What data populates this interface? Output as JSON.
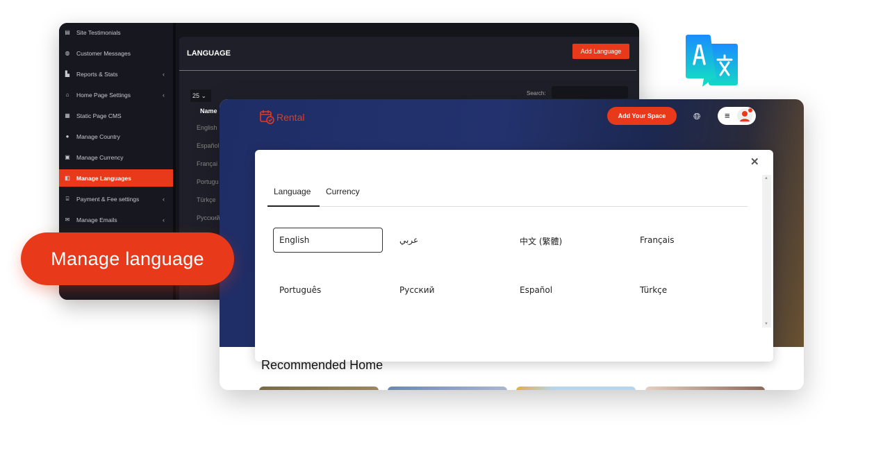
{
  "admin": {
    "sidebar": [
      {
        "label": "Site Testimonials",
        "icon": "testimonial-icon",
        "chevron": false
      },
      {
        "label": "Customer Messages",
        "icon": "chat-icon",
        "chevron": false
      },
      {
        "label": "Reports & Stats",
        "icon": "chart-icon",
        "chevron": true
      },
      {
        "label": "Home Page Settings",
        "icon": "home-icon",
        "chevron": true
      },
      {
        "label": "Static Page CMS",
        "icon": "page-icon",
        "chevron": false
      },
      {
        "label": "Manage Country",
        "icon": "globe-icon",
        "chevron": false
      },
      {
        "label": "Manage Currency",
        "icon": "money-icon",
        "chevron": false
      },
      {
        "label": "Manage Languages",
        "icon": "language-icon",
        "chevron": false,
        "active": true
      },
      {
        "label": "Payment & Fee settings",
        "icon": "bank-icon",
        "chevron": true
      },
      {
        "label": "Manage Emails",
        "icon": "mail-icon",
        "chevron": true
      }
    ],
    "title": "LANGUAGE",
    "add_button": "Add Language",
    "per_page": "25",
    "search_label": "Search:",
    "table_header": "Name",
    "rows": [
      "English",
      "Español",
      "Françai",
      "Portugu",
      "Türkçe",
      "Русский"
    ]
  },
  "front": {
    "logo": "Rental",
    "add_space": "Add Your Space",
    "modal": {
      "tabs": [
        "Language",
        "Currency"
      ],
      "active_tab": "Language",
      "languages": [
        "English",
        "عربي",
        "中文 (繁體)",
        "Français",
        "Português",
        "Русский",
        "Español",
        "Türkçe"
      ],
      "selected": "English"
    },
    "recommended": "Recommended Home"
  },
  "callout": "Manage language",
  "colors": {
    "accent": "#e8391a",
    "admin_bg": "#1f1f29",
    "hero": "#23326e"
  }
}
